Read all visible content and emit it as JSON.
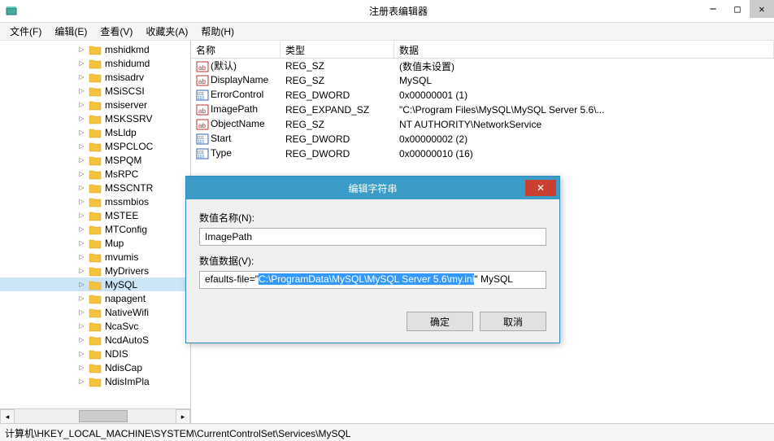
{
  "window": {
    "title": "注册表编辑器"
  },
  "menu": {
    "file": "文件(F)",
    "edit": "编辑(E)",
    "view": "查看(V)",
    "favorites": "收藏夹(A)",
    "help": "帮助(H)"
  },
  "tree": {
    "items": [
      {
        "label": "mshidkmd"
      },
      {
        "label": "mshidumd"
      },
      {
        "label": "msisadrv"
      },
      {
        "label": "MSiSCSI"
      },
      {
        "label": "msiserver"
      },
      {
        "label": "MSKSSRV"
      },
      {
        "label": "MsLldp"
      },
      {
        "label": "MSPCLOC"
      },
      {
        "label": "MSPQM"
      },
      {
        "label": "MsRPC"
      },
      {
        "label": "MSSCNTR"
      },
      {
        "label": "mssmbios"
      },
      {
        "label": "MSTEE"
      },
      {
        "label": "MTConfig"
      },
      {
        "label": "Mup"
      },
      {
        "label": "mvumis"
      },
      {
        "label": "MyDrivers"
      },
      {
        "label": "MySQL",
        "selected": true
      },
      {
        "label": "napagent"
      },
      {
        "label": "NativeWifi"
      },
      {
        "label": "NcaSvc"
      },
      {
        "label": "NcdAutoS"
      },
      {
        "label": "NDIS"
      },
      {
        "label": "NdisCap"
      },
      {
        "label": "NdisImPla"
      }
    ]
  },
  "list": {
    "columns": {
      "name": "名称",
      "type": "类型",
      "data": "数据"
    },
    "rows": [
      {
        "icon": "sz",
        "name": "(默认)",
        "type": "REG_SZ",
        "data": "(数值未设置)"
      },
      {
        "icon": "sz",
        "name": "DisplayName",
        "type": "REG_SZ",
        "data": "MySQL"
      },
      {
        "icon": "dw",
        "name": "ErrorControl",
        "type": "REG_DWORD",
        "data": "0x00000001 (1)"
      },
      {
        "icon": "sz",
        "name": "ImagePath",
        "type": "REG_EXPAND_SZ",
        "data": "\"C:\\Program Files\\MySQL\\MySQL Server 5.6\\..."
      },
      {
        "icon": "sz",
        "name": "ObjectName",
        "type": "REG_SZ",
        "data": "NT AUTHORITY\\NetworkService"
      },
      {
        "icon": "dw",
        "name": "Start",
        "type": "REG_DWORD",
        "data": "0x00000002 (2)"
      },
      {
        "icon": "dw",
        "name": "Type",
        "type": "REG_DWORD",
        "data": "0x00000010 (16)"
      }
    ]
  },
  "dialog": {
    "title": "编辑字符串",
    "name_label": "数值名称(N):",
    "name_value": "ImagePath",
    "data_label": "数值数据(V):",
    "data_prefix": "efaults-file=\"",
    "data_selected": "C:\\ProgramData\\MySQL\\MySQL Server 5.6\\my.ini",
    "data_suffix": "\" MySQL",
    "ok": "确定",
    "cancel": "取消"
  },
  "status": {
    "path": "计算机\\HKEY_LOCAL_MACHINE\\SYSTEM\\CurrentControlSet\\Services\\MySQL"
  }
}
